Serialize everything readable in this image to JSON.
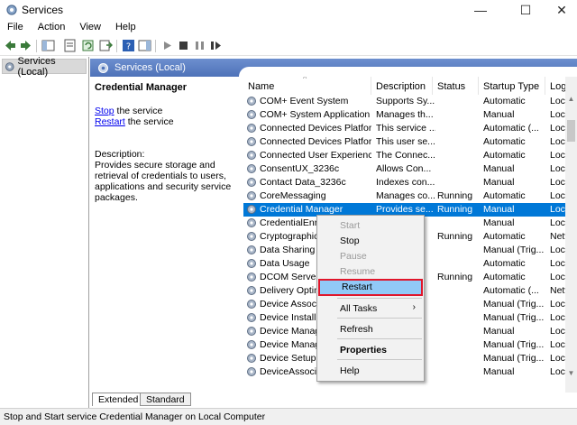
{
  "window": {
    "title": "Services"
  },
  "menu": [
    "File",
    "Action",
    "View",
    "Help"
  ],
  "tree": {
    "root_label": "Services (Local)"
  },
  "content": {
    "header_title": "Services (Local)",
    "selected_service": "Credential Manager",
    "stop_link": "Stop",
    "stop_suffix": " the service",
    "restart_link": "Restart",
    "restart_suffix": " the service",
    "description_label": "Description:",
    "description_text": "Provides secure storage and retrieval of credentials to users, applications and security service packages."
  },
  "columns": [
    "Name",
    "Description",
    "Status",
    "Startup Type",
    "Log"
  ],
  "rows": [
    {
      "name": "COM+ Event System",
      "desc": "Supports Sy...",
      "status": "",
      "startup": "Automatic",
      "log": "Loca"
    },
    {
      "name": "COM+ System Application",
      "desc": "Manages th...",
      "status": "",
      "startup": "Manual",
      "log": "Loca"
    },
    {
      "name": "Connected Devices Platfor...",
      "desc": "This service ...",
      "status": "",
      "startup": "Automatic (...",
      "log": "Loca"
    },
    {
      "name": "Connected Devices Platfor...",
      "desc": "This user se...",
      "status": "",
      "startup": "Automatic",
      "log": "Loca"
    },
    {
      "name": "Connected User Experience...",
      "desc": "The Connec...",
      "status": "",
      "startup": "Automatic",
      "log": "Loca"
    },
    {
      "name": "ConsentUX_3236c",
      "desc": "Allows Con...",
      "status": "",
      "startup": "Manual",
      "log": "Loca"
    },
    {
      "name": "Contact Data_3236c",
      "desc": "Indexes con...",
      "status": "",
      "startup": "Manual",
      "log": "Loca"
    },
    {
      "name": "CoreMessaging",
      "desc": "Manages co...",
      "status": "Running",
      "startup": "Automatic",
      "log": "Loca"
    },
    {
      "name": "Credential Manager",
      "desc": "Provides se...",
      "status": "Running",
      "startup": "Manual",
      "log": "Loca"
    },
    {
      "name": "CredentialEnro",
      "desc": "",
      "status": "",
      "startup": "Manual",
      "log": "Loca"
    },
    {
      "name": "Cryptographic",
      "desc": "",
      "status": "Running",
      "startup": "Automatic",
      "log": "Netv"
    },
    {
      "name": "Data Sharing S",
      "desc": "",
      "status": "",
      "startup": "Manual (Trig...",
      "log": "Loca"
    },
    {
      "name": "Data Usage",
      "desc": "",
      "status": "",
      "startup": "Automatic",
      "log": "Loca"
    },
    {
      "name": "DCOM Server P",
      "desc": "",
      "status": "Running",
      "startup": "Automatic",
      "log": "Loca"
    },
    {
      "name": "Delivery Optim",
      "desc": "",
      "status": "",
      "startup": "Automatic (...",
      "log": "Netv"
    },
    {
      "name": "Device Associa",
      "desc": "",
      "status": "",
      "startup": "Manual (Trig...",
      "log": "Loca"
    },
    {
      "name": "Device Install S",
      "desc": "",
      "status": "",
      "startup": "Manual (Trig...",
      "log": "Loca"
    },
    {
      "name": "Device Manage",
      "desc": "",
      "status": "",
      "startup": "Manual",
      "log": "Loca"
    },
    {
      "name": "Device Manage",
      "desc": "",
      "status": "",
      "startup": "Manual (Trig...",
      "log": "Loca"
    },
    {
      "name": "Device Setup M",
      "desc": "",
      "status": "",
      "startup": "Manual (Trig...",
      "log": "Loca"
    },
    {
      "name": "DeviceAssociat",
      "desc": "",
      "status": "",
      "startup": "Manual",
      "log": "Loca"
    }
  ],
  "selected_row_index": 8,
  "context_menu": {
    "start": "Start",
    "stop": "Stop",
    "pause": "Pause",
    "resume": "Resume",
    "restart": "Restart",
    "all_tasks": "All Tasks",
    "refresh": "Refresh",
    "properties": "Properties",
    "help": "Help"
  },
  "tabs": [
    "Extended",
    "Standard"
  ],
  "status_text": "Stop and Start service Credential Manager on Local Computer",
  "colors": {
    "selection": "#0078d7",
    "highlight_border": "#e0162b",
    "header": "#5a7ec2"
  }
}
